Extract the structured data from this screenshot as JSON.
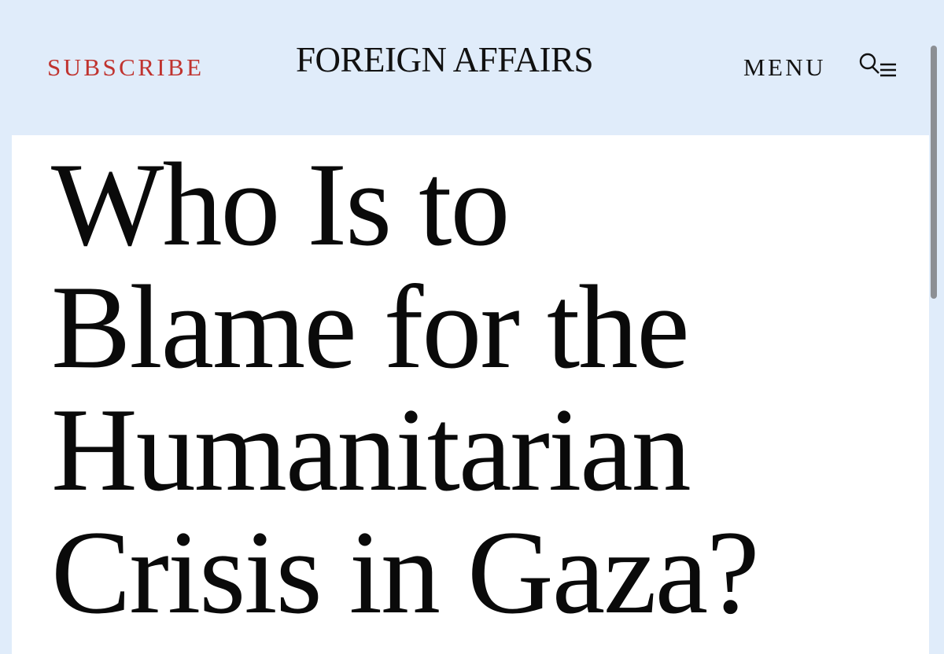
{
  "header": {
    "subscribe_label": "SUBSCRIBE",
    "masthead": "FOREIGN AFFAIRS",
    "menu_label": "MENU",
    "menu_icon": "search-menu-icon"
  },
  "article": {
    "title_lines": [
      "Who Is to",
      "Blame for the",
      "Humanitarian",
      "Crisis in Gaza?"
    ]
  },
  "colors": {
    "header_background": "#e0ecfa",
    "subscribe_accent": "#c0332f",
    "text": "#0a0a0a",
    "card_background": "#ffffff"
  }
}
